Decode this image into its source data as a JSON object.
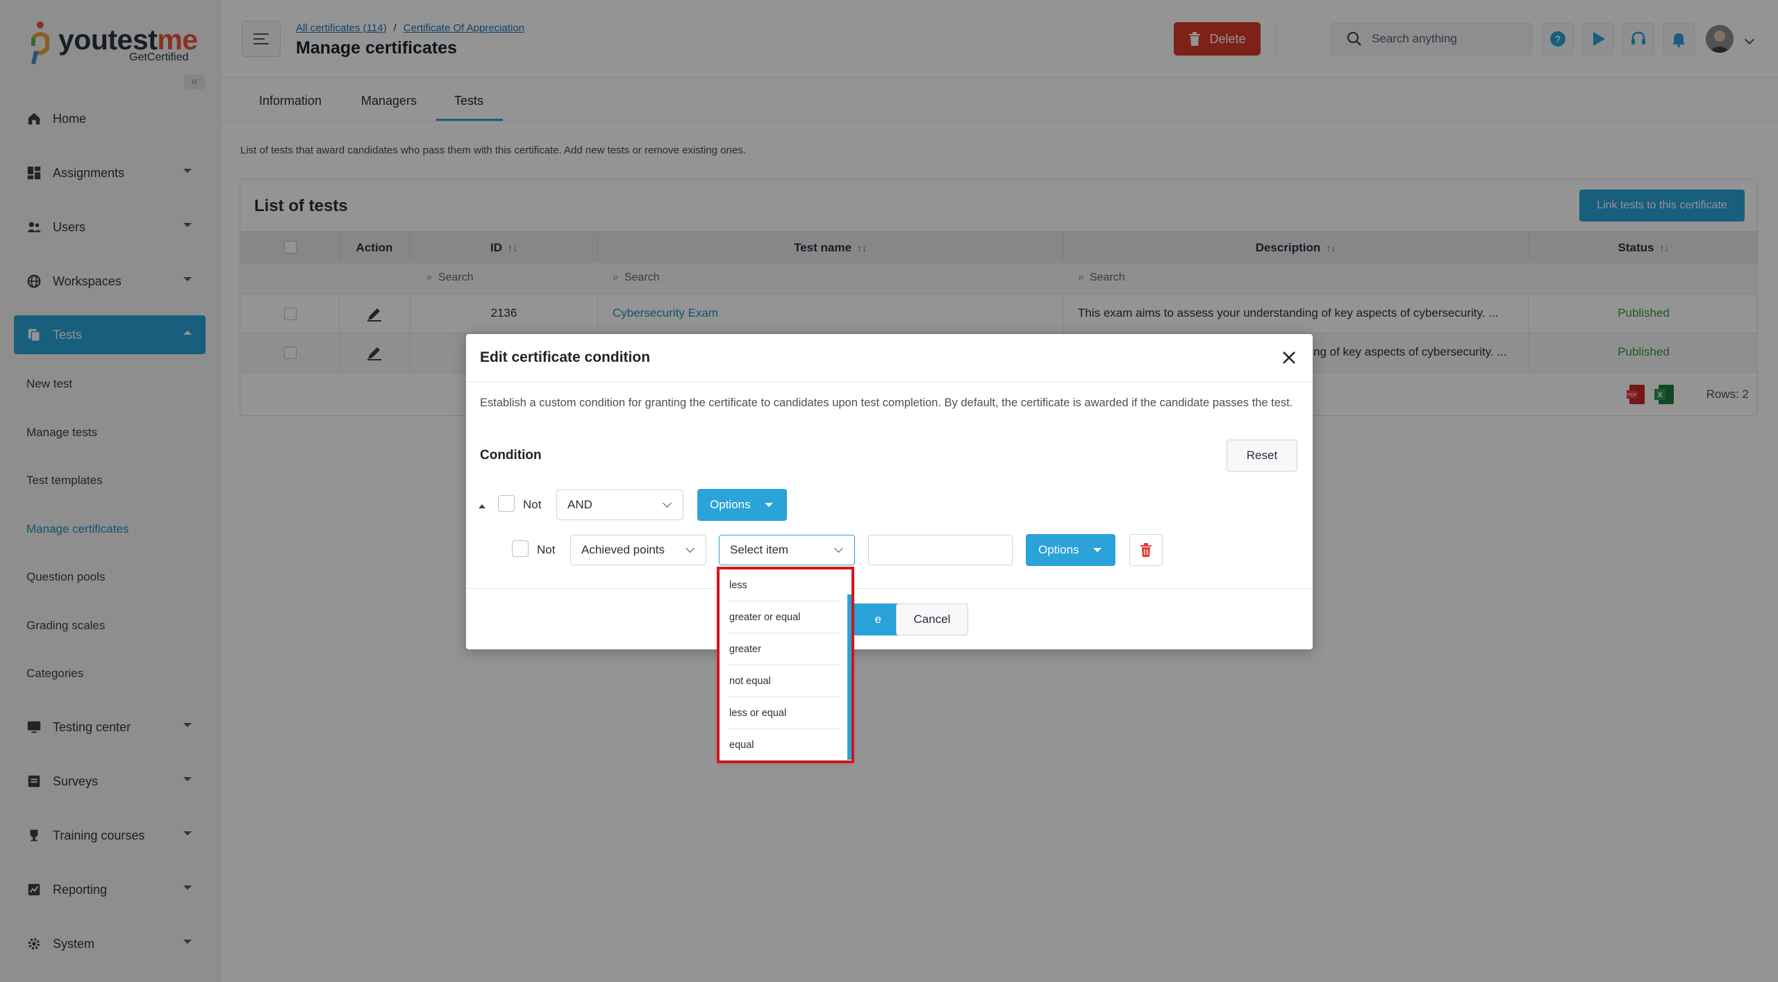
{
  "brand": {
    "name_prefix": "youtest",
    "name_accent": "me",
    "tagline": "GetCertified"
  },
  "sidebar": {
    "items": [
      {
        "label": "Home",
        "icon": "home-icon"
      },
      {
        "label": "Assignments",
        "icon": "dashboard-icon"
      },
      {
        "label": "Users",
        "icon": "users-icon"
      },
      {
        "label": "Workspaces",
        "icon": "globe-icon"
      },
      {
        "label": "Tests",
        "icon": "copy-icon"
      },
      {
        "label": "Testing center",
        "icon": "monitor-icon"
      },
      {
        "label": "Surveys",
        "icon": "list-icon"
      },
      {
        "label": "Training courses",
        "icon": "trophy-icon"
      },
      {
        "label": "Reporting",
        "icon": "chart-icon"
      },
      {
        "label": "System",
        "icon": "gear-icon"
      }
    ],
    "test_subitems": [
      "New test",
      "Manage tests",
      "Test templates",
      "Manage certificates",
      "Question pools",
      "Grading scales",
      "Categories"
    ]
  },
  "header": {
    "breadcrumb_1": "All certificates (114)",
    "breadcrumb_sep": "/",
    "breadcrumb_2": "Certificate Of Appreciation",
    "title": "Manage certificates",
    "delete_label": "Delete",
    "search_placeholder": "Search anything"
  },
  "tabs": [
    "Information",
    "Managers",
    "Tests"
  ],
  "intro": "List of tests that award candidates who pass them with this certificate. Add new tests or remove existing ones.",
  "card": {
    "title": "List of tests",
    "link_button": "Link tests to this certificate",
    "columns": {
      "action": "Action",
      "id": "ID",
      "test_name": "Test name",
      "description": "Description",
      "status": "Status"
    },
    "filter_placeholder": "Search",
    "rows": [
      {
        "id": "2136",
        "name": "Cybersecurity Exam",
        "description": "This exam aims to assess your understanding of key aspects of cybersecurity. ...",
        "status": "Published"
      },
      {
        "id": "",
        "name": "",
        "description": "ng of key aspects of cybersecurity. ...",
        "status": "Published"
      }
    ],
    "rows_count": "Rows: 2"
  },
  "modal": {
    "title": "Edit certificate condition",
    "description": "Establish a custom condition for granting the certificate to candidates upon test completion. By default, the certificate is awarded if the candidate passes the test.",
    "condition_label": "Condition",
    "reset_label": "Reset",
    "not_label": "Not",
    "group_operator": "AND",
    "options_label": "Options",
    "field_value": "Achieved points",
    "operator_placeholder": "Select item",
    "save_label_partial": "e",
    "cancel_label": "Cancel"
  },
  "dropdown": {
    "options": [
      "less",
      "greater or equal",
      "greater",
      "not equal",
      "less or equal",
      "equal"
    ]
  },
  "colors": {
    "primary": "#2aa3d8",
    "danger": "#d93a2b",
    "published": "#3a9a3e",
    "highlight": "#e3171d"
  }
}
